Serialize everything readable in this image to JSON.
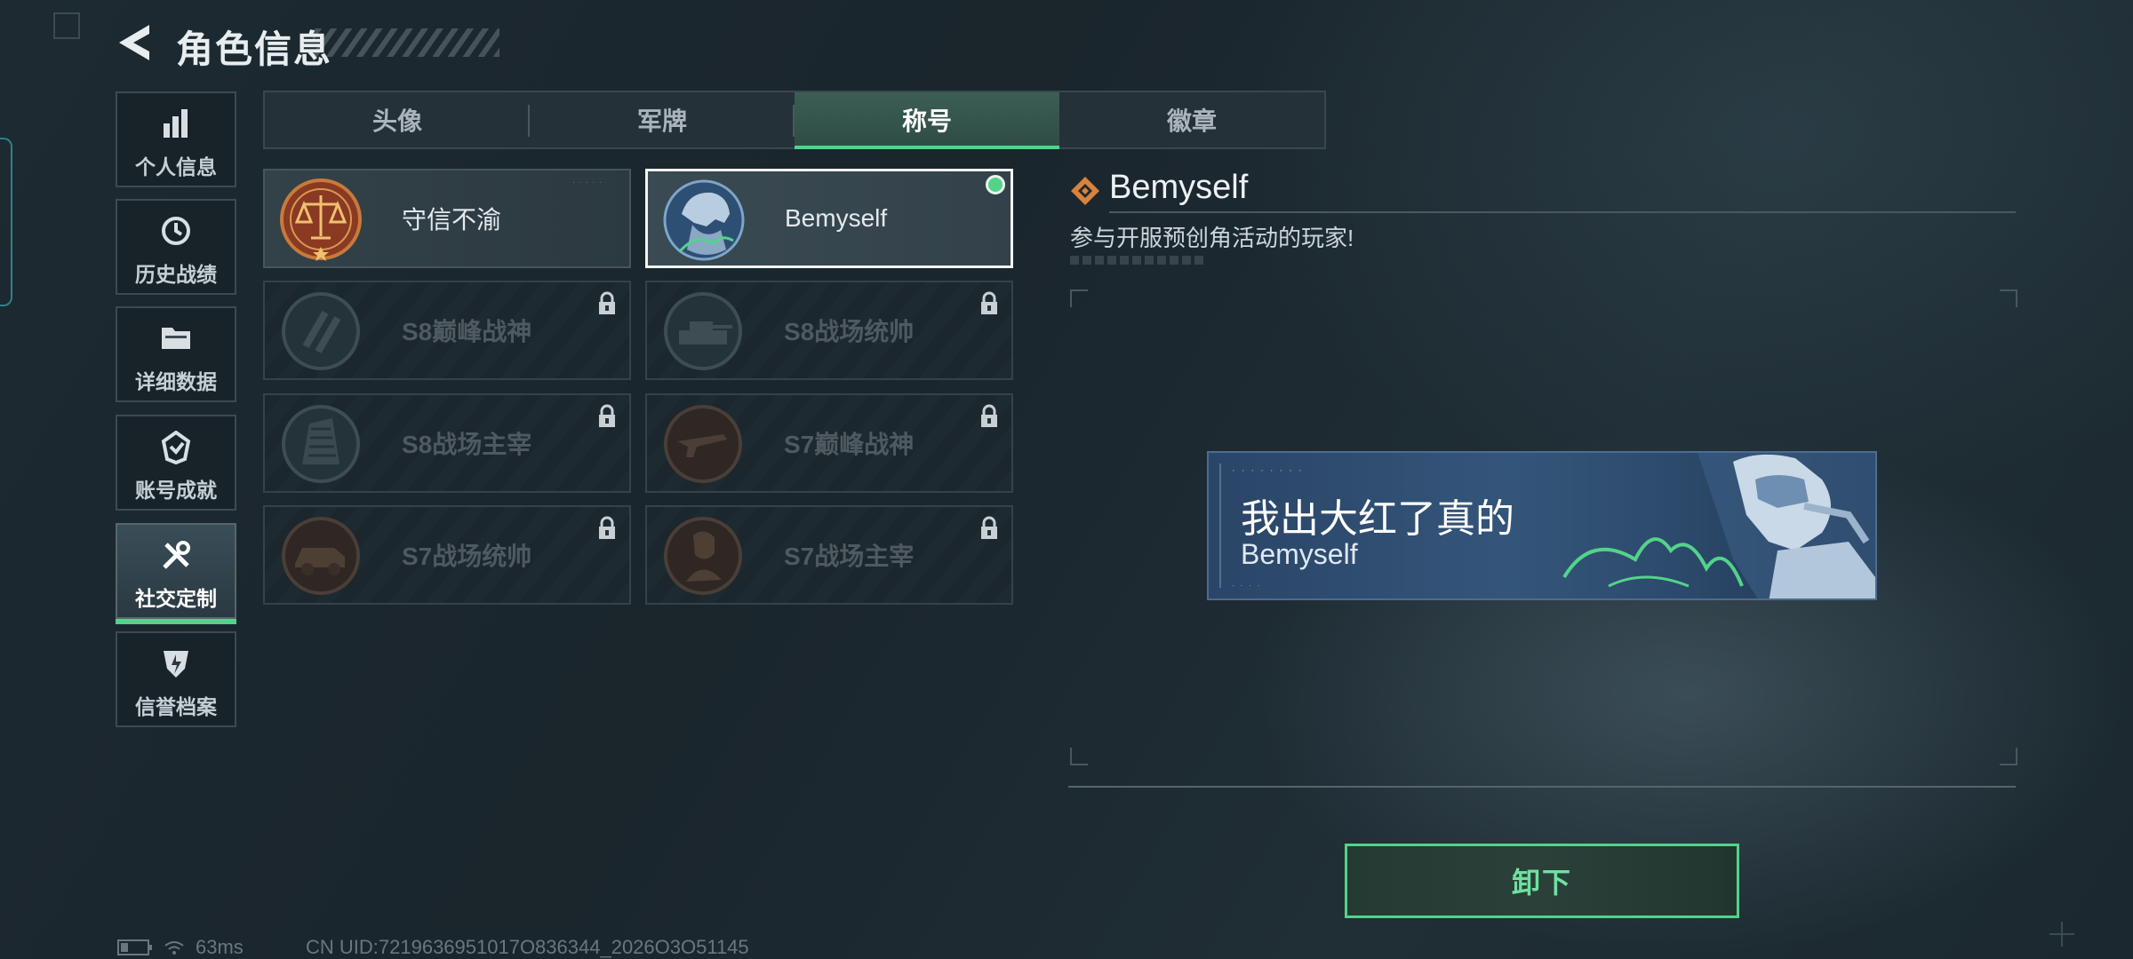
{
  "header": {
    "title": "角色信息"
  },
  "sidebar": {
    "items": [
      {
        "label": "个人信息",
        "icon": "bar-chart-icon"
      },
      {
        "label": "历史战绩",
        "icon": "clock-icon"
      },
      {
        "label": "详细数据",
        "icon": "folder-icon"
      },
      {
        "label": "账号成就",
        "icon": "achievement-icon"
      },
      {
        "label": "社交定制",
        "icon": "tools-icon",
        "active": true
      },
      {
        "label": "信誉档案",
        "icon": "shield-icon"
      }
    ]
  },
  "tabs": [
    {
      "label": "头像"
    },
    {
      "label": "军牌"
    },
    {
      "label": "称号",
      "active": true
    },
    {
      "label": "徽章"
    }
  ],
  "titles": [
    {
      "name": "守信不渝",
      "state": "unlocked",
      "icon": "scales-medal-icon"
    },
    {
      "name": "Bemyself",
      "state": "selected",
      "equipped": true,
      "icon": "soldier-medal-icon"
    },
    {
      "name": "S8巅峰战神",
      "state": "locked",
      "icon": "stripes-medal-icon"
    },
    {
      "name": "S8战场统帅",
      "state": "locked",
      "icon": "tank-medal-icon"
    },
    {
      "name": "S8战场主宰",
      "state": "locked",
      "icon": "building-medal-icon"
    },
    {
      "name": "S7巅峰战神",
      "state": "locked",
      "icon": "gun-medal-icon"
    },
    {
      "name": "S7战场统帅",
      "state": "locked",
      "icon": "vehicle-medal-icon"
    },
    {
      "name": "S7战场主宰",
      "state": "locked",
      "icon": "soldier-bust-medal-icon"
    }
  ],
  "detail": {
    "name": "Bemyself",
    "description": "参与开服预创角活动的玩家!",
    "banner": {
      "title": "我出大红了真的",
      "subtitle": "Bemyself"
    }
  },
  "actions": {
    "unequip": "卸下"
  },
  "status": {
    "ping": "63ms",
    "uid": "CN UID:7219636951017O836344_2026O3O51145"
  },
  "colors": {
    "accent": "#53d38a",
    "background": "#1d2a31"
  }
}
